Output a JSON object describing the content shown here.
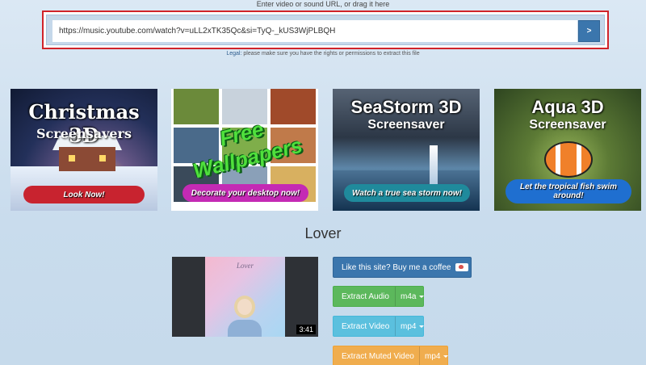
{
  "header": {
    "prompt": "Enter video or sound URL, or drag it here"
  },
  "url_bar": {
    "value": "https://music.youtube.com/watch?v=uLL2xTK35Qc&si=TyQ-_kUS3WjPLBQH",
    "go_label": ">"
  },
  "legal": {
    "label": "Legal:",
    "text": " please make sure you have the rights or permissions to extract this file"
  },
  "ads": [
    {
      "title": "Christmas 3D",
      "subtitle": "Screensavers",
      "cta": "Look Now!",
      "cta_color": "#c8232f"
    },
    {
      "title": "Free Wallpapers",
      "subtitle": "",
      "cta": "Decorate your desktop now!",
      "cta_color": "#c42ab4"
    },
    {
      "title": "SeaStorm 3D",
      "subtitle": "Screensaver",
      "cta": "Watch a true sea storm now!",
      "cta_color": "#1f8a9c"
    },
    {
      "title": "Aqua 3D",
      "subtitle": "Screensaver",
      "cta": "Let the tropical fish swim around!",
      "cta_color": "#1f6fd0"
    }
  ],
  "media": {
    "title": "Lover",
    "thumbnail_art_title": "Lover",
    "duration": "3:41"
  },
  "actions": {
    "coffee": "Like this site? Buy me a coffee",
    "extract_audio": "Extract Audio",
    "audio_format": "m4a",
    "extract_video": "Extract Video",
    "video_format": "mp4",
    "extract_muted": "Extract Muted Video",
    "muted_format": "mp4"
  },
  "colors": {
    "highlight_border": "#d0232a",
    "primary": "#3b76ad",
    "success": "#5cb85c",
    "info": "#5bc0de",
    "warning": "#f0ad4e"
  }
}
